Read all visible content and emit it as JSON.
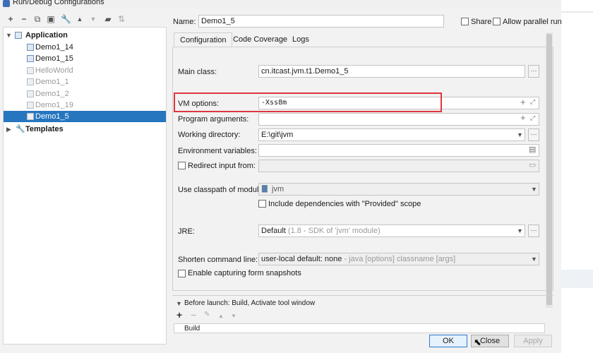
{
  "window": {
    "title": "Run/Debug Configurations"
  },
  "toolbar": {
    "icons": [
      "plus-icon",
      "minus-icon",
      "copy-icon",
      "save-icon",
      "wrench-icon",
      "arrow-up-icon",
      "arrow-down-icon",
      "folder-icon",
      "sort-icon"
    ]
  },
  "tree": {
    "root_label": "Application",
    "items": [
      {
        "label": "Demo1_14",
        "dim": false
      },
      {
        "label": "Demo1_15",
        "dim": false
      },
      {
        "label": "HelloWorld",
        "dim": true
      },
      {
        "label": "Demo1_1",
        "dim": true
      },
      {
        "label": "Demo1_2",
        "dim": true
      },
      {
        "label": "Demo1_19",
        "dim": true
      },
      {
        "label": "Demo1_5",
        "dim": true,
        "selected": true
      }
    ],
    "templates_label": "Templates"
  },
  "header": {
    "name_label": "Name:",
    "name_value": "Demo1_5",
    "share_label": "Share",
    "parallel_label": "Allow parallel run"
  },
  "tabs": [
    "Configuration",
    "Code Coverage",
    "Logs"
  ],
  "form": {
    "main_class_label": "Main class:",
    "main_class_value": "cn.itcast.jvm.t1.Demo1_5",
    "vm_options_label": "VM options:",
    "vm_options_value": "-Xss8m",
    "program_args_label": "Program arguments:",
    "program_args_value": "",
    "working_dir_label": "Working directory:",
    "working_dir_value": "E:\\git\\jvm",
    "env_vars_label": "Environment variables:",
    "env_vars_value": "",
    "redirect_label": "Redirect input from:",
    "classpath_label": "Use classpath of module:",
    "classpath_value": "jvm",
    "include_deps_label": "Include dependencies with \"Provided\" scope",
    "jre_label": "JRE:",
    "jre_value": "Default",
    "jre_detail": " (1.8 - SDK of 'jvm' module)",
    "shorten_label": "Shorten command line:",
    "shorten_value": "user-local default: none",
    "shorten_detail": " - java [options] classname [args]",
    "snapshots_label": "Enable capturing form snapshots"
  },
  "before_launch": {
    "title": "Before launch: Build, Activate tool window",
    "item": "Build"
  },
  "buttons": {
    "ok": "OK",
    "close": "Close",
    "apply": "Apply"
  },
  "colors": {
    "selection": "#2675bf",
    "highlight_box": "#e0363f",
    "default_button_border": "#2d7ad6"
  }
}
